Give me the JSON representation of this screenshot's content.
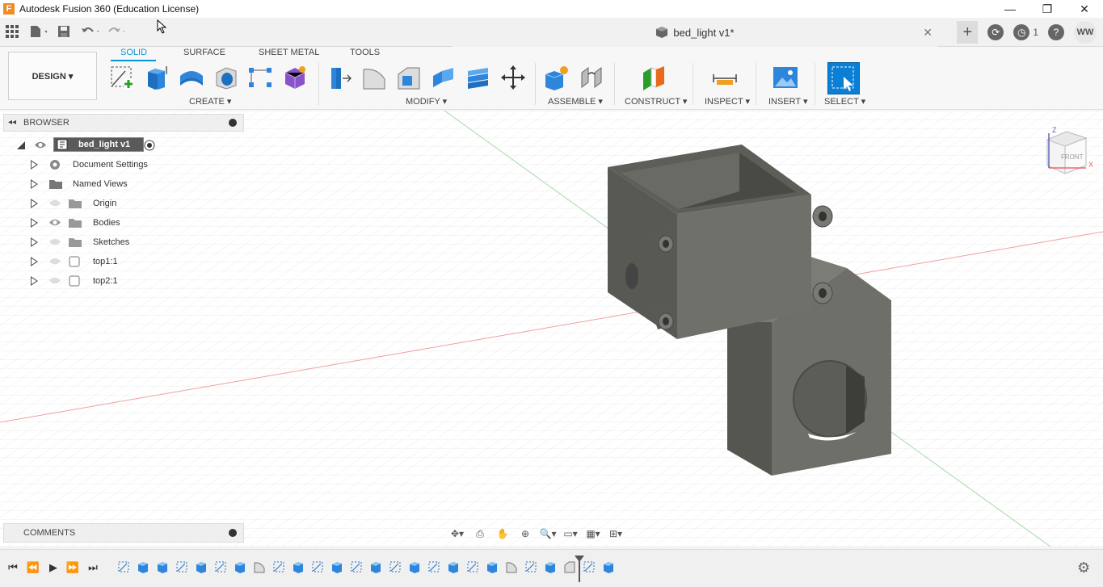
{
  "app": {
    "title": "Autodesk Fusion 360 (Education License)",
    "logo_letter": "F"
  },
  "window": {
    "min": "—",
    "restore": "❐",
    "close": "✕"
  },
  "document": {
    "title": "bed_light v1*"
  },
  "user": {
    "initials": "WW",
    "jobs_count": "1"
  },
  "workspace": {
    "label": "DESIGN ▾"
  },
  "tabs": [
    {
      "label": "SOLID",
      "active": true
    },
    {
      "label": "SURFACE",
      "active": false
    },
    {
      "label": "SHEET METAL",
      "active": false
    },
    {
      "label": "TOOLS",
      "active": false
    }
  ],
  "groups": {
    "create": "CREATE ▾",
    "modify": "MODIFY ▾",
    "assemble": "ASSEMBLE ▾",
    "construct": "CONSTRUCT ▾",
    "inspect": "INSPECT ▾",
    "insert": "INSERT ▾",
    "select": "SELECT ▾"
  },
  "browser": {
    "title": "BROWSER",
    "root": "bed_light v1",
    "items": [
      {
        "label": "Document Settings",
        "icon": "gear-icon"
      },
      {
        "label": "Named Views",
        "icon": "folder-icon"
      },
      {
        "label": "Origin",
        "icon": "folder-icon"
      },
      {
        "label": "Bodies",
        "icon": "folder-icon"
      },
      {
        "label": "Sketches",
        "icon": "folder-icon"
      },
      {
        "label": "top1:1",
        "icon": "component-icon"
      },
      {
        "label": "top2:1",
        "icon": "component-icon"
      }
    ]
  },
  "comments": {
    "title": "COMMENTS"
  },
  "viewcube": {
    "face": "FRONT",
    "axis_z": "Z",
    "axis_x": "X"
  },
  "colors": {
    "accent": "#0696d7",
    "model": "#6b6b66",
    "selected": "#0a7fd6"
  }
}
